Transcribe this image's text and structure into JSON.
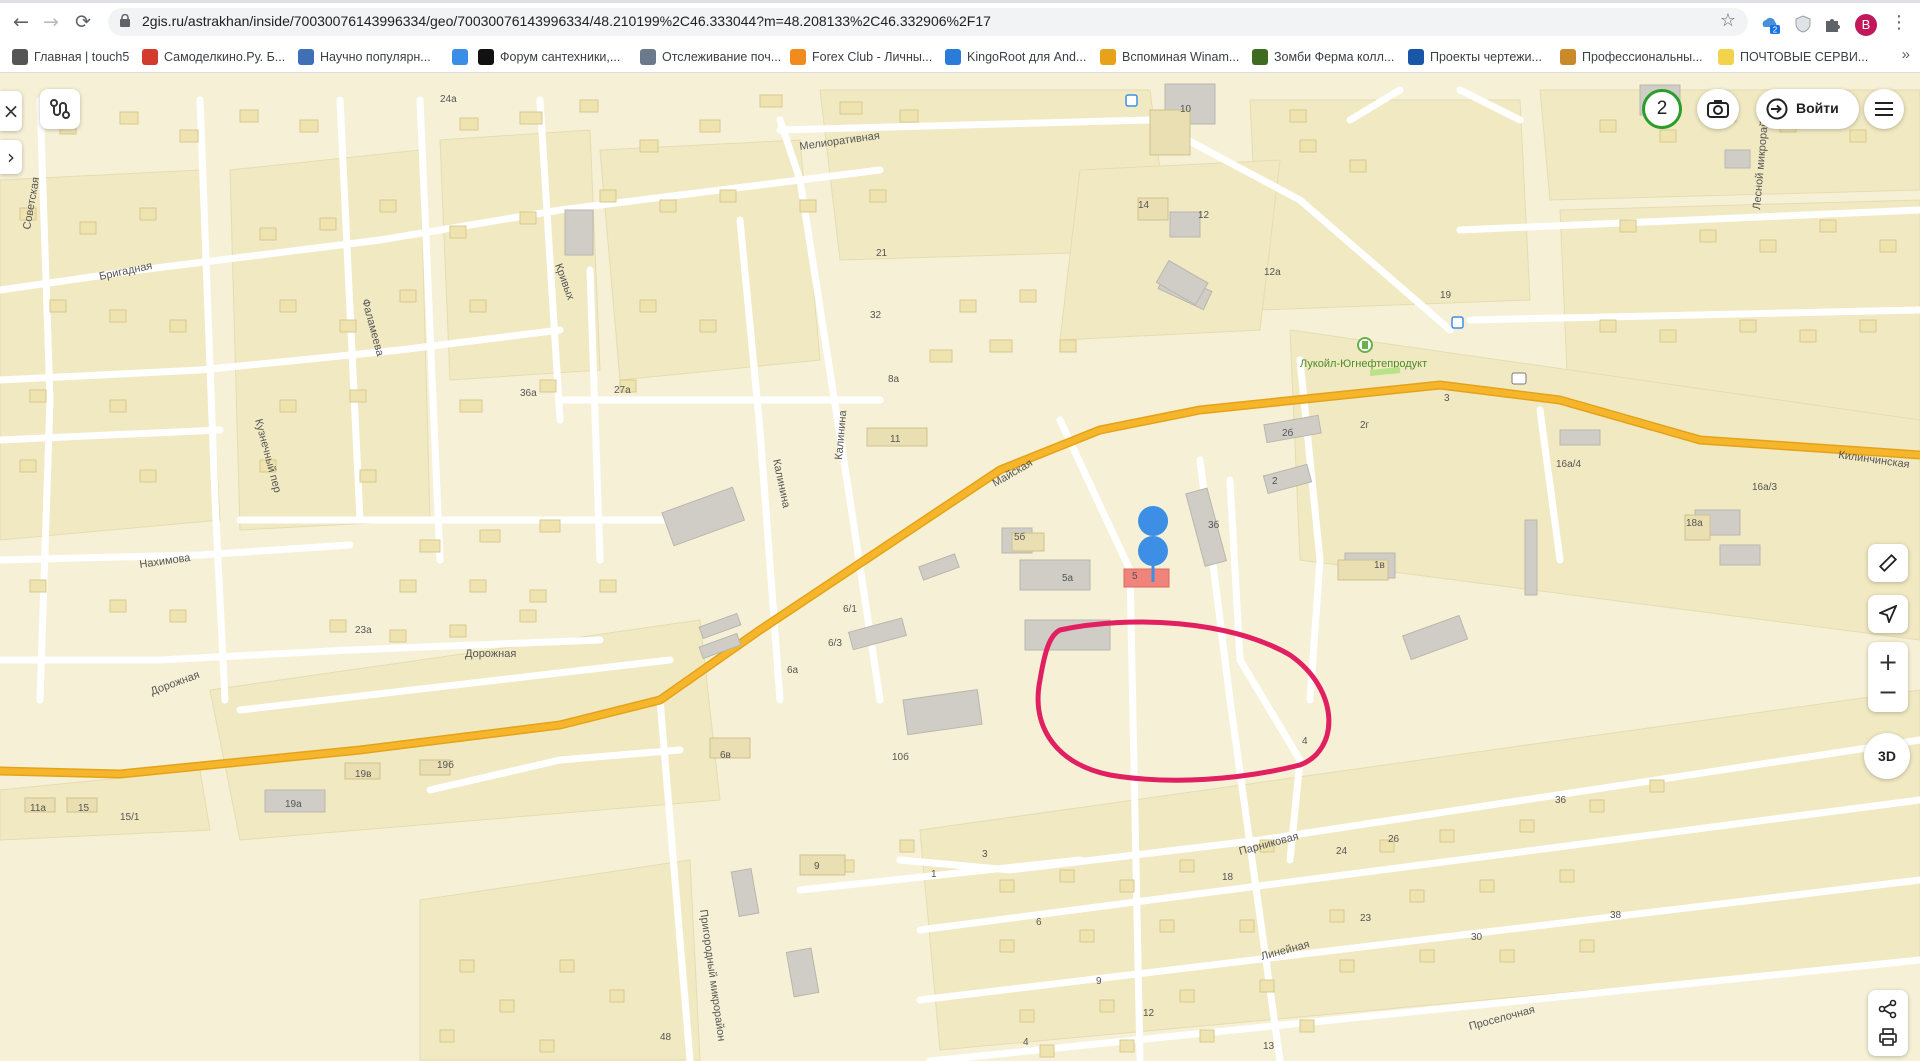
{
  "browser": {
    "url": "2gis.ru/astrakhan/inside/70030076143996334/geo/70030076143996334/48.210199%2C46.333044?m=48.208133%2C46.332906%2F17",
    "profile_initial": "B",
    "ext_badge": "2",
    "bookmarks": [
      {
        "label": "Главная | touch5",
        "color": "#555555"
      },
      {
        "label": "Самоделкино.Ру. Б...",
        "color": "#d33b2f"
      },
      {
        "label": "Научно популярн...",
        "color": "#3f6fb5"
      },
      {
        "label": "",
        "color": "#3a8ee6"
      },
      {
        "label": "Форум сантехники,...",
        "color": "#111111"
      },
      {
        "label": "Отслеживание поч...",
        "color": "#6a7a8c"
      },
      {
        "label": "Forex Club - Личны...",
        "color": "#f28b1e"
      },
      {
        "label": "KingoRoot для And...",
        "color": "#2b7bd8"
      },
      {
        "label": "Вспоминая Winam...",
        "color": "#e8a21a"
      },
      {
        "label": "Зомби Ферма колл...",
        "color": "#3e6b1f"
      },
      {
        "label": "Проекты чертежи...",
        "color": "#1a56a8"
      },
      {
        "label": "Профессиональны...",
        "color": "#c98b2a"
      },
      {
        "label": "ПОЧТОВЫЕ СЕРВИ...",
        "color": "#f2d34b"
      }
    ],
    "bookmarks_more": "»"
  },
  "map": {
    "streets": [
      "Мелиоративная",
      "Советская",
      "Бригадная",
      "Фаламеева",
      "Кривых",
      "Кузнечный пер",
      "Калинина",
      "Калинина",
      "Майская",
      "Нахимова",
      "Дорожная",
      "Дорожная",
      "Пригородный микрорайон",
      "Парниковая",
      "Линейная",
      "Проселочная",
      "Лесной микрорайон",
      "Килинчинская"
    ],
    "poi_label": "Лукойл-Югнефтепродукт",
    "house_numbers": [
      "24а",
      "10",
      "14",
      "12",
      "12а",
      "21",
      "32",
      "19",
      "8а",
      "11",
      "3",
      "2б",
      "2г",
      "2",
      "3б",
      "5б",
      "5а",
      "5",
      "1в",
      "16а/4",
      "16а/3",
      "18а",
      "6/1",
      "6/3",
      "6а",
      "23а",
      "36а",
      "27а",
      "10б",
      "6в",
      "19в",
      "19б",
      "19а",
      "11а",
      "15",
      "15/1",
      "9",
      "1",
      "3",
      "4",
      "26",
      "24",
      "18",
      "36",
      "6",
      "23",
      "30",
      "38",
      "9",
      "12",
      "4",
      "13",
      "48"
    ],
    "route_color": "#f2b025",
    "marker_color": "#3d8fe6",
    "highlight_color": "#e02060",
    "selected_building_color": "#f0837a"
  },
  "controls": {
    "login_label": "Войти",
    "badge_count": "2",
    "three_d_label": "3D",
    "zoom_in": "+",
    "zoom_out": "−",
    "close": "×",
    "expand": "›"
  }
}
